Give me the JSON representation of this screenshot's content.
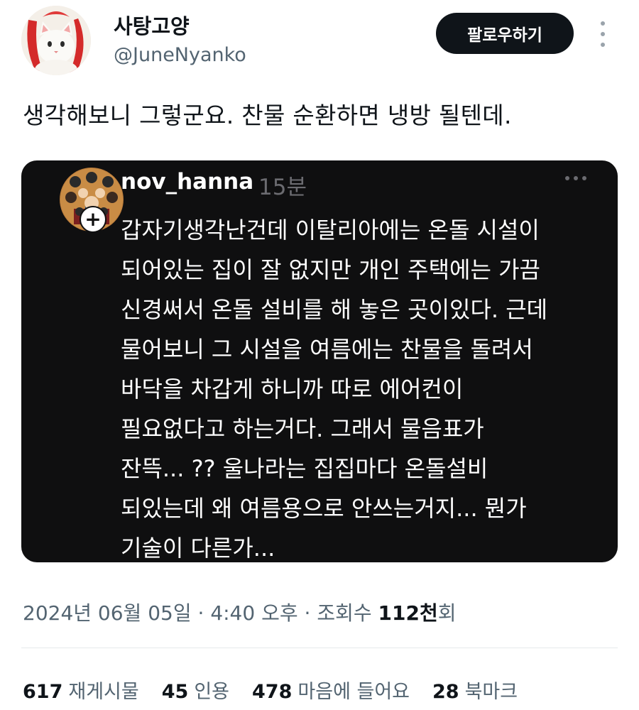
{
  "author": {
    "display_name": "사탕고양",
    "handle": "@JuneNyanko",
    "avatar_icon": "cat-avatar-icon"
  },
  "follow_button": {
    "label": "팔로우하기"
  },
  "more_menu_icon": "more-vertical-icon",
  "tweet": {
    "text": "생각해보니 그렇군요. 찬물 순환하면 냉방 될텐데."
  },
  "quote": {
    "author": "nov_hanna",
    "time": "15분",
    "more_icon": "more-horizontal-icon",
    "follow_plus": "+",
    "lines": [
      "갑자기생각난건데 이탈리아에는 온돌 시설이",
      "되어있는 집이 잘 없지만 개인 주택에는 가끔",
      "신경써서 온돌 설비를 해 놓은 곳이있다. 근데",
      "물어보니 그 시설을 여름에는 찬물을 돌려서",
      "바닥을 차갑게 하니까 따로 에어컨이",
      "필요없다고 하는거다. 그래서 물음표가",
      "잔뜩... ?? 울나라는 집집마다 온돌설비",
      "되있는데 왜 여름용으로 안쓰는거지... 뭔가",
      "기술이 다른가..."
    ]
  },
  "meta": {
    "date": "2024년 06월 05일",
    "sep1": " · ",
    "time": "4:40 오후",
    "sep2": " · ",
    "views_label": "조회수 ",
    "views_value": "112천",
    "views_suffix": "회"
  },
  "stats": {
    "retweets": {
      "count": "617",
      "label": "재게시물"
    },
    "quotes": {
      "count": "45",
      "label": "인용"
    },
    "likes": {
      "count": "478",
      "label": "마음에 들어요"
    },
    "bookmarks": {
      "count": "28",
      "label": "북마크"
    }
  },
  "colors": {
    "text_primary": "#0f1419",
    "text_secondary": "#536471",
    "quote_bg": "#0f0f10",
    "button_bg": "#0f1419"
  }
}
